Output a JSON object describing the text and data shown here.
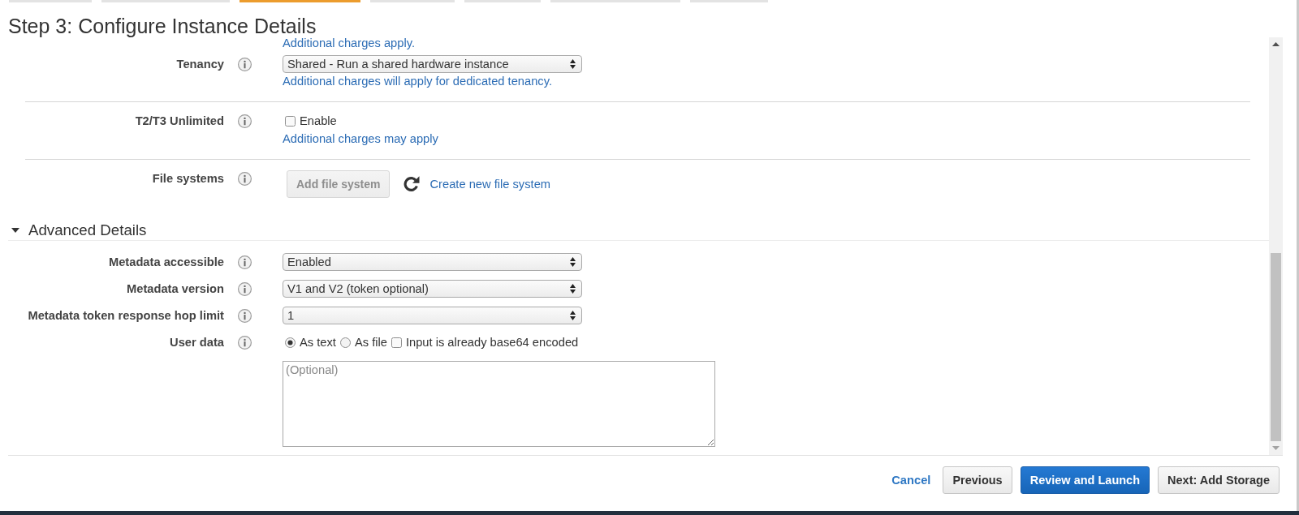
{
  "wizard_steps": [
    {
      "selected": false
    },
    {
      "selected": false
    },
    {
      "selected": true
    },
    {
      "selected": false
    },
    {
      "selected": false
    },
    {
      "selected": false
    },
    {
      "selected": false
    }
  ],
  "page_title": "Step 3: Configure Instance Details",
  "form": {
    "carryover_note": "Additional charges apply.",
    "fields": [
      {
        "kind": "select",
        "label": "Tenancy",
        "value": "Shared - Run a shared hardware instance",
        "note": "Additional charges will apply for dedicated tenancy."
      },
      {
        "kind": "checkbox",
        "label": "T2/T3 Unlimited",
        "option": "Enable",
        "checked": false,
        "note": "Additional charges may apply"
      },
      {
        "kind": "file_systems",
        "label": "File systems",
        "button": {
          "label": "Add file system",
          "disabled": true
        },
        "link": "Create new file system"
      }
    ]
  },
  "advanced_details": {
    "title": "Advanced Details",
    "expanded": true,
    "fields": [
      {
        "kind": "select",
        "label": "Metadata accessible",
        "value": "Enabled"
      },
      {
        "kind": "select",
        "label": "Metadata version",
        "value": "V1 and V2 (token optional)"
      },
      {
        "kind": "select",
        "label": "Metadata token response hop limit",
        "value": "1"
      },
      {
        "kind": "user_data",
        "label": "User data",
        "options": [
          {
            "kind": "radio",
            "label": "As text",
            "selected": true
          },
          {
            "kind": "radio",
            "label": "As file",
            "selected": false
          },
          {
            "kind": "checkbox",
            "label": "Input is already base64 encoded",
            "checked": false
          }
        ],
        "placeholder": "(Optional)"
      }
    ]
  },
  "footer": {
    "cancel": "Cancel",
    "buttons": [
      {
        "kind": "secondary",
        "label": "Previous"
      },
      {
        "kind": "primary",
        "label": "Review and Launch"
      },
      {
        "kind": "secondary",
        "label": "Next: Add Storage"
      }
    ]
  }
}
